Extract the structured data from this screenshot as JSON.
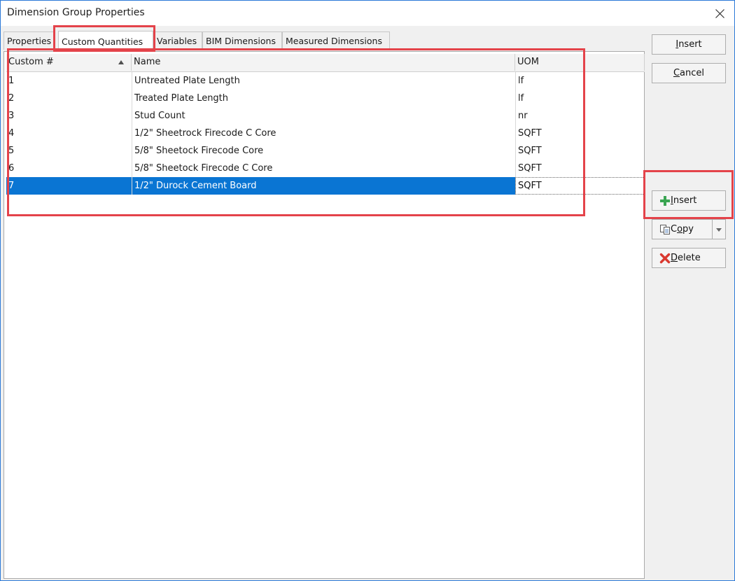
{
  "window": {
    "title": "Dimension Group Properties"
  },
  "tabs": [
    {
      "label": "Properties"
    },
    {
      "label": "Custom Quantities"
    },
    {
      "label": "Variables"
    },
    {
      "label": "BIM Dimensions"
    },
    {
      "label": "Measured Dimensions"
    }
  ],
  "active_tab": "Custom Quantities",
  "grid": {
    "columns": [
      "Custom #",
      "Name",
      "UOM"
    ],
    "sort": {
      "column": "Custom #",
      "direction": "ascending"
    },
    "rows": [
      {
        "num": "1",
        "name": "Untreated Plate Length",
        "uom": "lf"
      },
      {
        "num": "2",
        "name": "Treated Plate Length",
        "uom": "lf"
      },
      {
        "num": "3",
        "name": "Stud Count",
        "uom": "nr"
      },
      {
        "num": "4",
        "name": "1/2\" Sheetrock Firecode C Core",
        "uom": "SQFT"
      },
      {
        "num": "5",
        "name": "5/8\" Sheetock Firecode Core",
        "uom": "SQFT"
      },
      {
        "num": "6",
        "name": "5/8\" Sheetock Firecode C Core",
        "uom": "SQFT"
      },
      {
        "num": "7",
        "name": "1/2\" Durock Cement Board",
        "uom": "SQFT"
      }
    ],
    "selected_row": 7
  },
  "buttons": {
    "insert_top": {
      "first": "I",
      "rest": "nsert"
    },
    "cancel": {
      "first": "C",
      "rest": "ancel"
    },
    "insert_row": {
      "first": "I",
      "rest": "nsert"
    },
    "copy": {
      "pre": "C",
      "u": "o",
      "post": "py"
    },
    "delete": {
      "first": "D",
      "rest": "elete"
    }
  },
  "colors": {
    "selection": "#0a75d3",
    "highlight_box": "#e4434a",
    "insert_icon": "#3aa552",
    "delete_icon": "#d9382f"
  }
}
